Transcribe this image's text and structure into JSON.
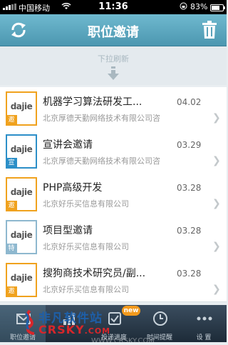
{
  "status_bar": {
    "carrier": "中国移动",
    "time": "11:36",
    "battery": "83%",
    "battery_level": 0.83
  },
  "navbar": {
    "title": "职位邀请",
    "refresh_icon": "refresh-icon",
    "trash_icon": "trash-icon"
  },
  "pull_to_refresh": {
    "text": "下拉刷新",
    "arrow_icon": "arrow-down-icon"
  },
  "items": [
    {
      "logo": "dajie",
      "tag": "邀",
      "tag_color": "#f0a21e",
      "border_color": "#f0a21e",
      "title": "机器学习算法研发工...",
      "date": "04.02",
      "company": "北京厚德天勤网络技术有限公司咨"
    },
    {
      "logo": "dajie",
      "tag": "宣",
      "tag_color": "#2c8fc8",
      "border_color": "#2c8fc8",
      "title": "宣讲会邀请",
      "date": "03.29",
      "company": "北京厚德天勤网络技术有限公司咨"
    },
    {
      "logo": "dajie",
      "tag": "邀",
      "tag_color": "#f0a21e",
      "border_color": "#f0a21e",
      "title": "PHP高级开发",
      "date": "03.28",
      "company": "北京好乐买信息有限公司"
    },
    {
      "logo": "dajie",
      "tag": "特",
      "tag_color": "#8eb8cf",
      "border_color": "#8eb8cf",
      "title": "项目型邀请",
      "date": "03.28",
      "company": "北京好乐买信息有限公司"
    },
    {
      "logo": "dajie",
      "tag": "邀",
      "tag_color": "#f0a21e",
      "border_color": "#f0a21e",
      "title": "搜狗商技术研究员/副...",
      "date": "03.28",
      "company": "北京好乐买信息有限公司"
    }
  ],
  "tabbar": {
    "tabs": [
      {
        "label": "职位邀请",
        "icon": "mail-icon"
      },
      {
        "label": "",
        "icon": "chart-icon"
      },
      {
        "label": "投递进度",
        "icon": "progress-icon"
      },
      {
        "label": "时间提醒",
        "icon": "clock-icon"
      },
      {
        "label": "设 置",
        "icon": "more-icon"
      }
    ],
    "badge": "new"
  },
  "watermark": {
    "line1": "非凡软件站",
    "line2": "CRSKY",
    "line3": ".COM",
    "site": "WWW.CRSKY.COM"
  },
  "colors": {
    "navbar": "#4c97b0",
    "accent_orange": "#f0a21e",
    "accent_blue": "#2c8fc8"
  }
}
